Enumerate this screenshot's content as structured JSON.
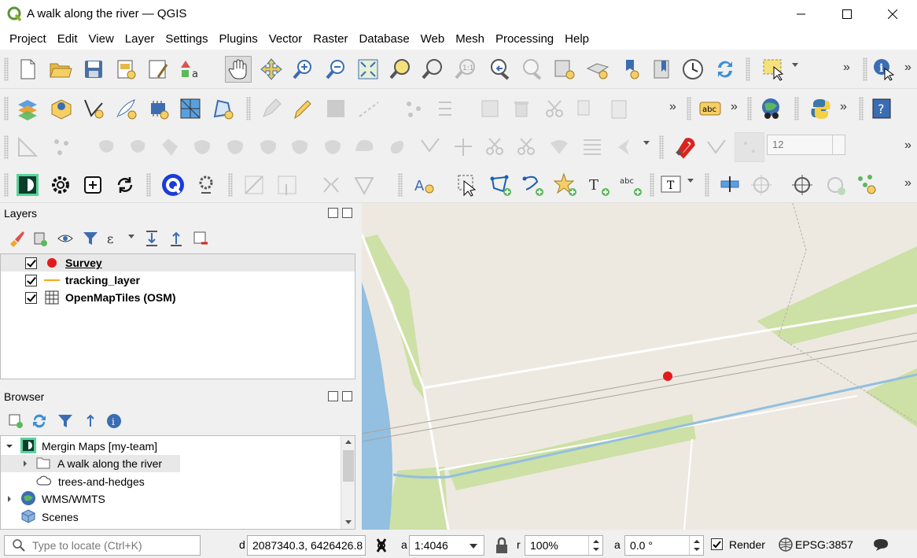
{
  "window": {
    "title": "A walk along the river — QGIS",
    "app_icon": "qgis-logo-icon",
    "controls": [
      "minimize-icon",
      "maximize-icon",
      "close-icon"
    ]
  },
  "menu": [
    "Project",
    "Edit",
    "View",
    "Layer",
    "Settings",
    "Plugins",
    "Vector",
    "Raster",
    "Database",
    "Web",
    "Mesh",
    "Processing",
    "Help"
  ],
  "toolbar3": {
    "snapping_tolerance": "12"
  },
  "layers_panel": {
    "title": "Layers",
    "toolbar_icons": [
      "style-icon",
      "add-group-icon",
      "visibility-icon",
      "filter-icon",
      "expression-filter-icon",
      "expand-all-icon",
      "collapse-all-icon",
      "remove-layer-icon"
    ],
    "items": [
      {
        "name": "Survey",
        "checked": true,
        "symbol": "red-point-icon",
        "selected": true
      },
      {
        "name": "tracking_layer",
        "checked": true,
        "symbol": "orange-line-icon",
        "selected": false
      },
      {
        "name": "OpenMapTiles (OSM)",
        "checked": true,
        "symbol": "raster-grid-icon",
        "selected": false
      }
    ]
  },
  "browser_panel": {
    "title": "Browser",
    "toolbar_icons": [
      "add-selected-icon",
      "refresh-icon",
      "filter-icon",
      "collapse-icon",
      "properties-icon"
    ],
    "items": [
      {
        "label": "Mergin Maps [my-team]",
        "icon": "mergin-maps-icon",
        "expanded": true
      },
      {
        "label": "A walk along the river",
        "icon": "folder-icon",
        "expanded": false
      },
      {
        "label": "trees-and-hedges",
        "icon": "cloud-icon"
      },
      {
        "label": "WMS/WMTS",
        "icon": "globe-icon",
        "expanded": false
      },
      {
        "label": "Scenes",
        "icon": "cube-icon"
      }
    ]
  },
  "map": {
    "colors": {
      "land": "#ede9e1",
      "water": "#93bfe0",
      "grass": "#cde0a5",
      "road": "#ffffff",
      "survey_point": "#e31a1c"
    }
  },
  "status": {
    "locate_placeholder": "Type to locate (Ctrl+K)",
    "coordinate_label": "d",
    "coordinate": "2087340.3, 6426426.8",
    "scale_label": "a",
    "scale": "1:4046",
    "magnifier_label": "r",
    "magnifier": "100%",
    "rotation_label": "a",
    "rotation": "0.0 °",
    "render_label": "Render",
    "render_checked": true,
    "crs": "EPSG:3857"
  }
}
